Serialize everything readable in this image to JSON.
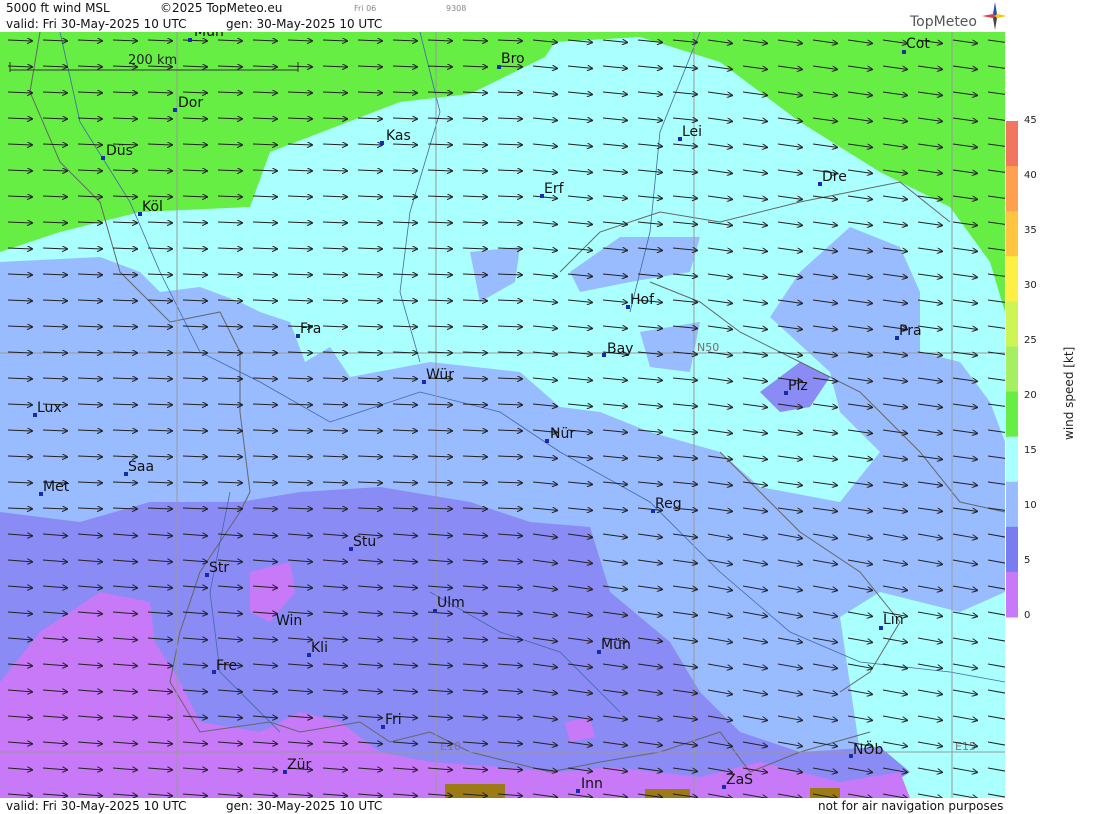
{
  "header": {
    "title": "5000 ft wind MSL",
    "copyright": "©2025 TopMeteo.eu",
    "day_code": "Fri 06",
    "run_code": "9308",
    "valid": "valid:  Fri  30-May-2025  10 UTC",
    "gen": "gen: 30-May-2025 10 UTC",
    "brand": "TopMeteo"
  },
  "footer": {
    "valid": "valid:  Fri  30-May-2025  10 UTC",
    "gen": "gen: 30-May-2025 10 UTC",
    "note": "not for air navigation purposes"
  },
  "map": {
    "scale_label": "200 km",
    "grid_labels": [
      "N50",
      "E10",
      "E15"
    ],
    "cities": [
      "Mün",
      "Bro",
      "Cot",
      "Dor",
      "Kas",
      "Lei",
      "Düs",
      "Erf",
      "Dre",
      "Köl",
      "Hof",
      "Fra",
      "Pra",
      "Bay",
      "Wür",
      "Plz",
      "Lux",
      "Nür",
      "Saa",
      "Met",
      "Reg",
      "Stu",
      "Str",
      "Ulm",
      "Win",
      "Lin",
      "Kli",
      "Mün",
      "Fre",
      "Fri",
      "NÖb",
      "Zür",
      "ZaS",
      "Inn"
    ]
  },
  "legend": {
    "unit": "wind  speed  [kt]",
    "ticks": [
      "45",
      "40",
      "35",
      "30",
      "25",
      "20",
      "15",
      "10",
      "5",
      "0"
    ],
    "colors": [
      "#f27560",
      "#ff9f50",
      "#ffc540",
      "#ffee44",
      "#cdf555",
      "#a6ef62",
      "#66ee44",
      "#aaffff",
      "#99bbff",
      "#7a7df0",
      "#c779f8"
    ]
  },
  "wind_colors": {
    "green": "#66ee44",
    "cyan": "#aaffff",
    "light_blue": "#99bbff",
    "blue": "#8a8bf5",
    "violet": "#c779f8",
    "terrain": "#9c7a15"
  }
}
